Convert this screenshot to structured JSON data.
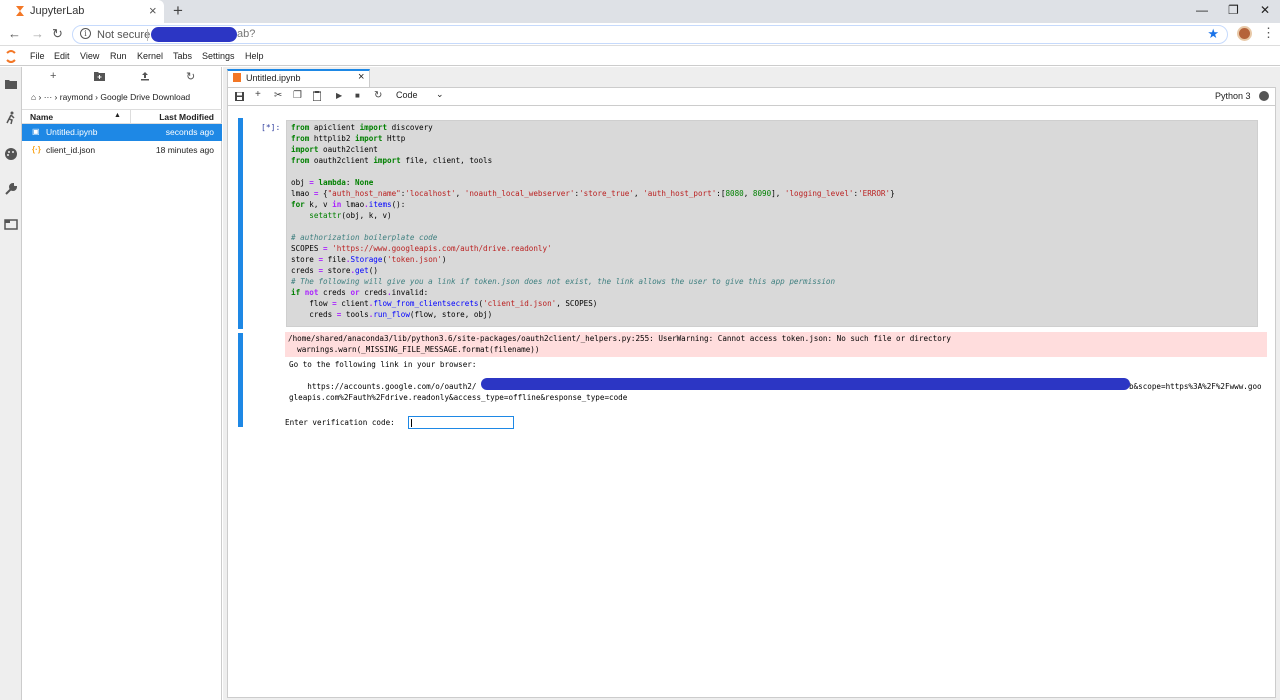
{
  "browser": {
    "tab_title": "JupyterLab",
    "security": "Not secure",
    "url_visible": "ab?"
  },
  "menu": [
    "File",
    "Edit",
    "View",
    "Run",
    "Kernel",
    "Tabs",
    "Settings",
    "Help"
  ],
  "filebrowser": {
    "breadcrumb": "› ··· › raymond › Google Drive Download",
    "col_name": "Name",
    "col_modified": "Last Modified",
    "files": [
      {
        "name": "Untitled.ipynb",
        "modified": "seconds ago"
      },
      {
        "name": "client_id.json",
        "modified": "18 minutes ago"
      }
    ]
  },
  "notebook": {
    "tab_title": "Untitled.ipynb",
    "cell_type": "Code",
    "kernel": "Python 3",
    "prompt": "[*]:",
    "output": {
      "warn1": "/home/shared/anaconda3/lib/python3.6/site-packages/oauth2client/_helpers.py:255: UserWarning: Cannot access token.json: No such file or directory",
      "warn2": "  warnings.warn(_MISSING_FILE_MESSAGE.format(filename))",
      "line1": "Go to the following link in your browser:",
      "url_start": "    https://accounts.google.com/o/oauth2/",
      "url_end": "b&scope=https%3A%2F%2Fwww.goo",
      "url_line2": "gleapis.com%2Fauth%2Fdrive.readonly&access_type=offline&response_type=code",
      "verify": "Enter verification code:"
    }
  },
  "colors": {
    "accent": "#1e88e5",
    "redaction": "#2c36c4",
    "stderr": "#ffdddd"
  }
}
